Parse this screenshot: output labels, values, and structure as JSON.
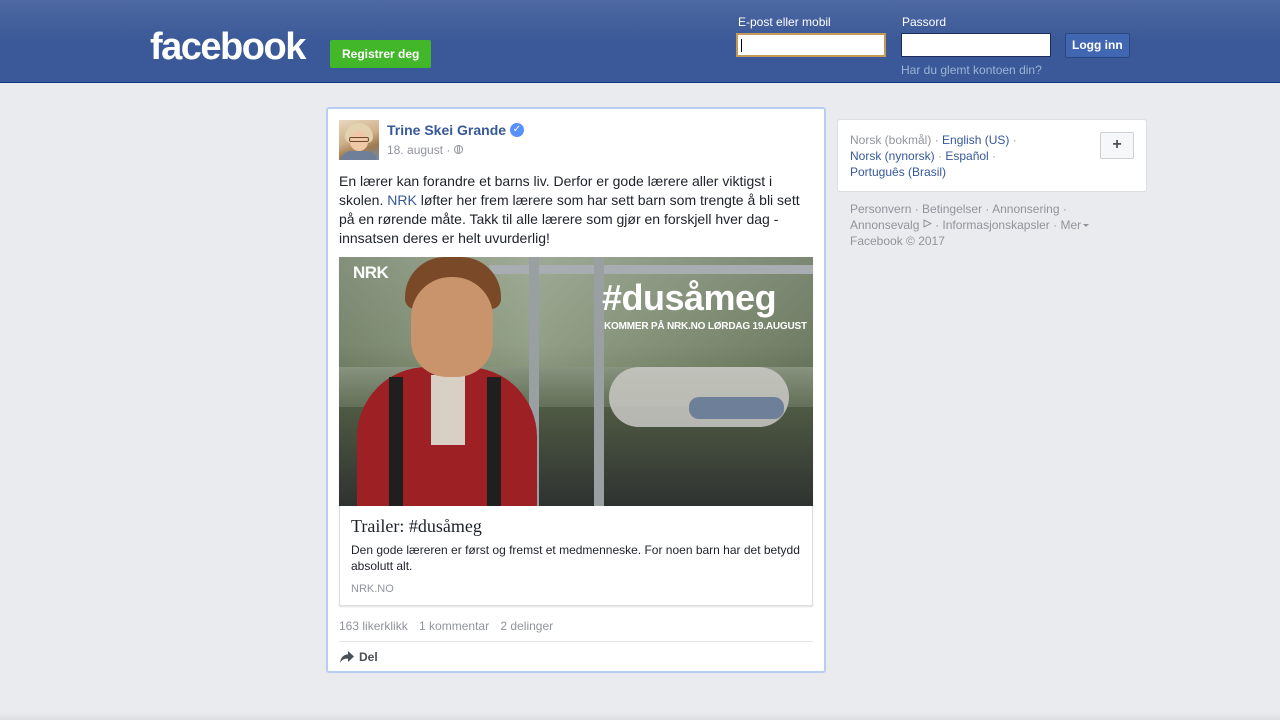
{
  "header": {
    "logo": "facebook",
    "register_label": "Registrer deg",
    "email_label": "E-post eller mobil",
    "email_value": "",
    "password_label": "Passord",
    "password_value": "",
    "login_label": "Logg inn",
    "forgot_label": "Har du glemt kontoen din?",
    "brand_color": "#3b5998"
  },
  "post": {
    "author": "Trine Skei Grande",
    "date": "18. august",
    "date_separator": "·",
    "text_before_link": "En lærer kan forandre et barns liv. Derfor er gode lærere aller viktigst i skolen. ",
    "link_text": "NRK",
    "text_after_link": " løfter her frem lærere som har sett barn som trengte å bli sett på en rørende måte. Takk til alle lærere som gjør en forskjell hver dag - innsatsen deres er helt uvurderlig!",
    "preview": {
      "image_logo": "NRK",
      "image_hashtag": "#dusåmeg",
      "image_caption": "KOMMER PÅ NRK.NO LØRDAG 19.AUGUST",
      "title": "Trailer: #dusåmeg",
      "description": "Den gode læreren er først og fremst et medmenneske. For noen barn har det betydd absolutt alt.",
      "domain": "NRK.NO"
    },
    "stats": {
      "likes": "163 likerklikk",
      "comments": "1 kommentar",
      "shares": "2 delinger"
    },
    "share_label": "Del",
    "icons": [
      "verified-icon",
      "globe-icon",
      "share-arrow-icon"
    ]
  },
  "sidebar": {
    "languages": {
      "current": "Norsk (bokmål)",
      "sep": " · ",
      "items": [
        "English (US)",
        "Norsk (nynorsk)",
        "Español",
        "Português (Brasil)"
      ]
    },
    "plus_label": "+",
    "footer": {
      "links": [
        "Personvern",
        "Betingelser",
        "Annonsering",
        "Annonsevalg",
        "Informasjonskapsler",
        "Mer"
      ],
      "copyright": "Facebook © 2017"
    }
  }
}
